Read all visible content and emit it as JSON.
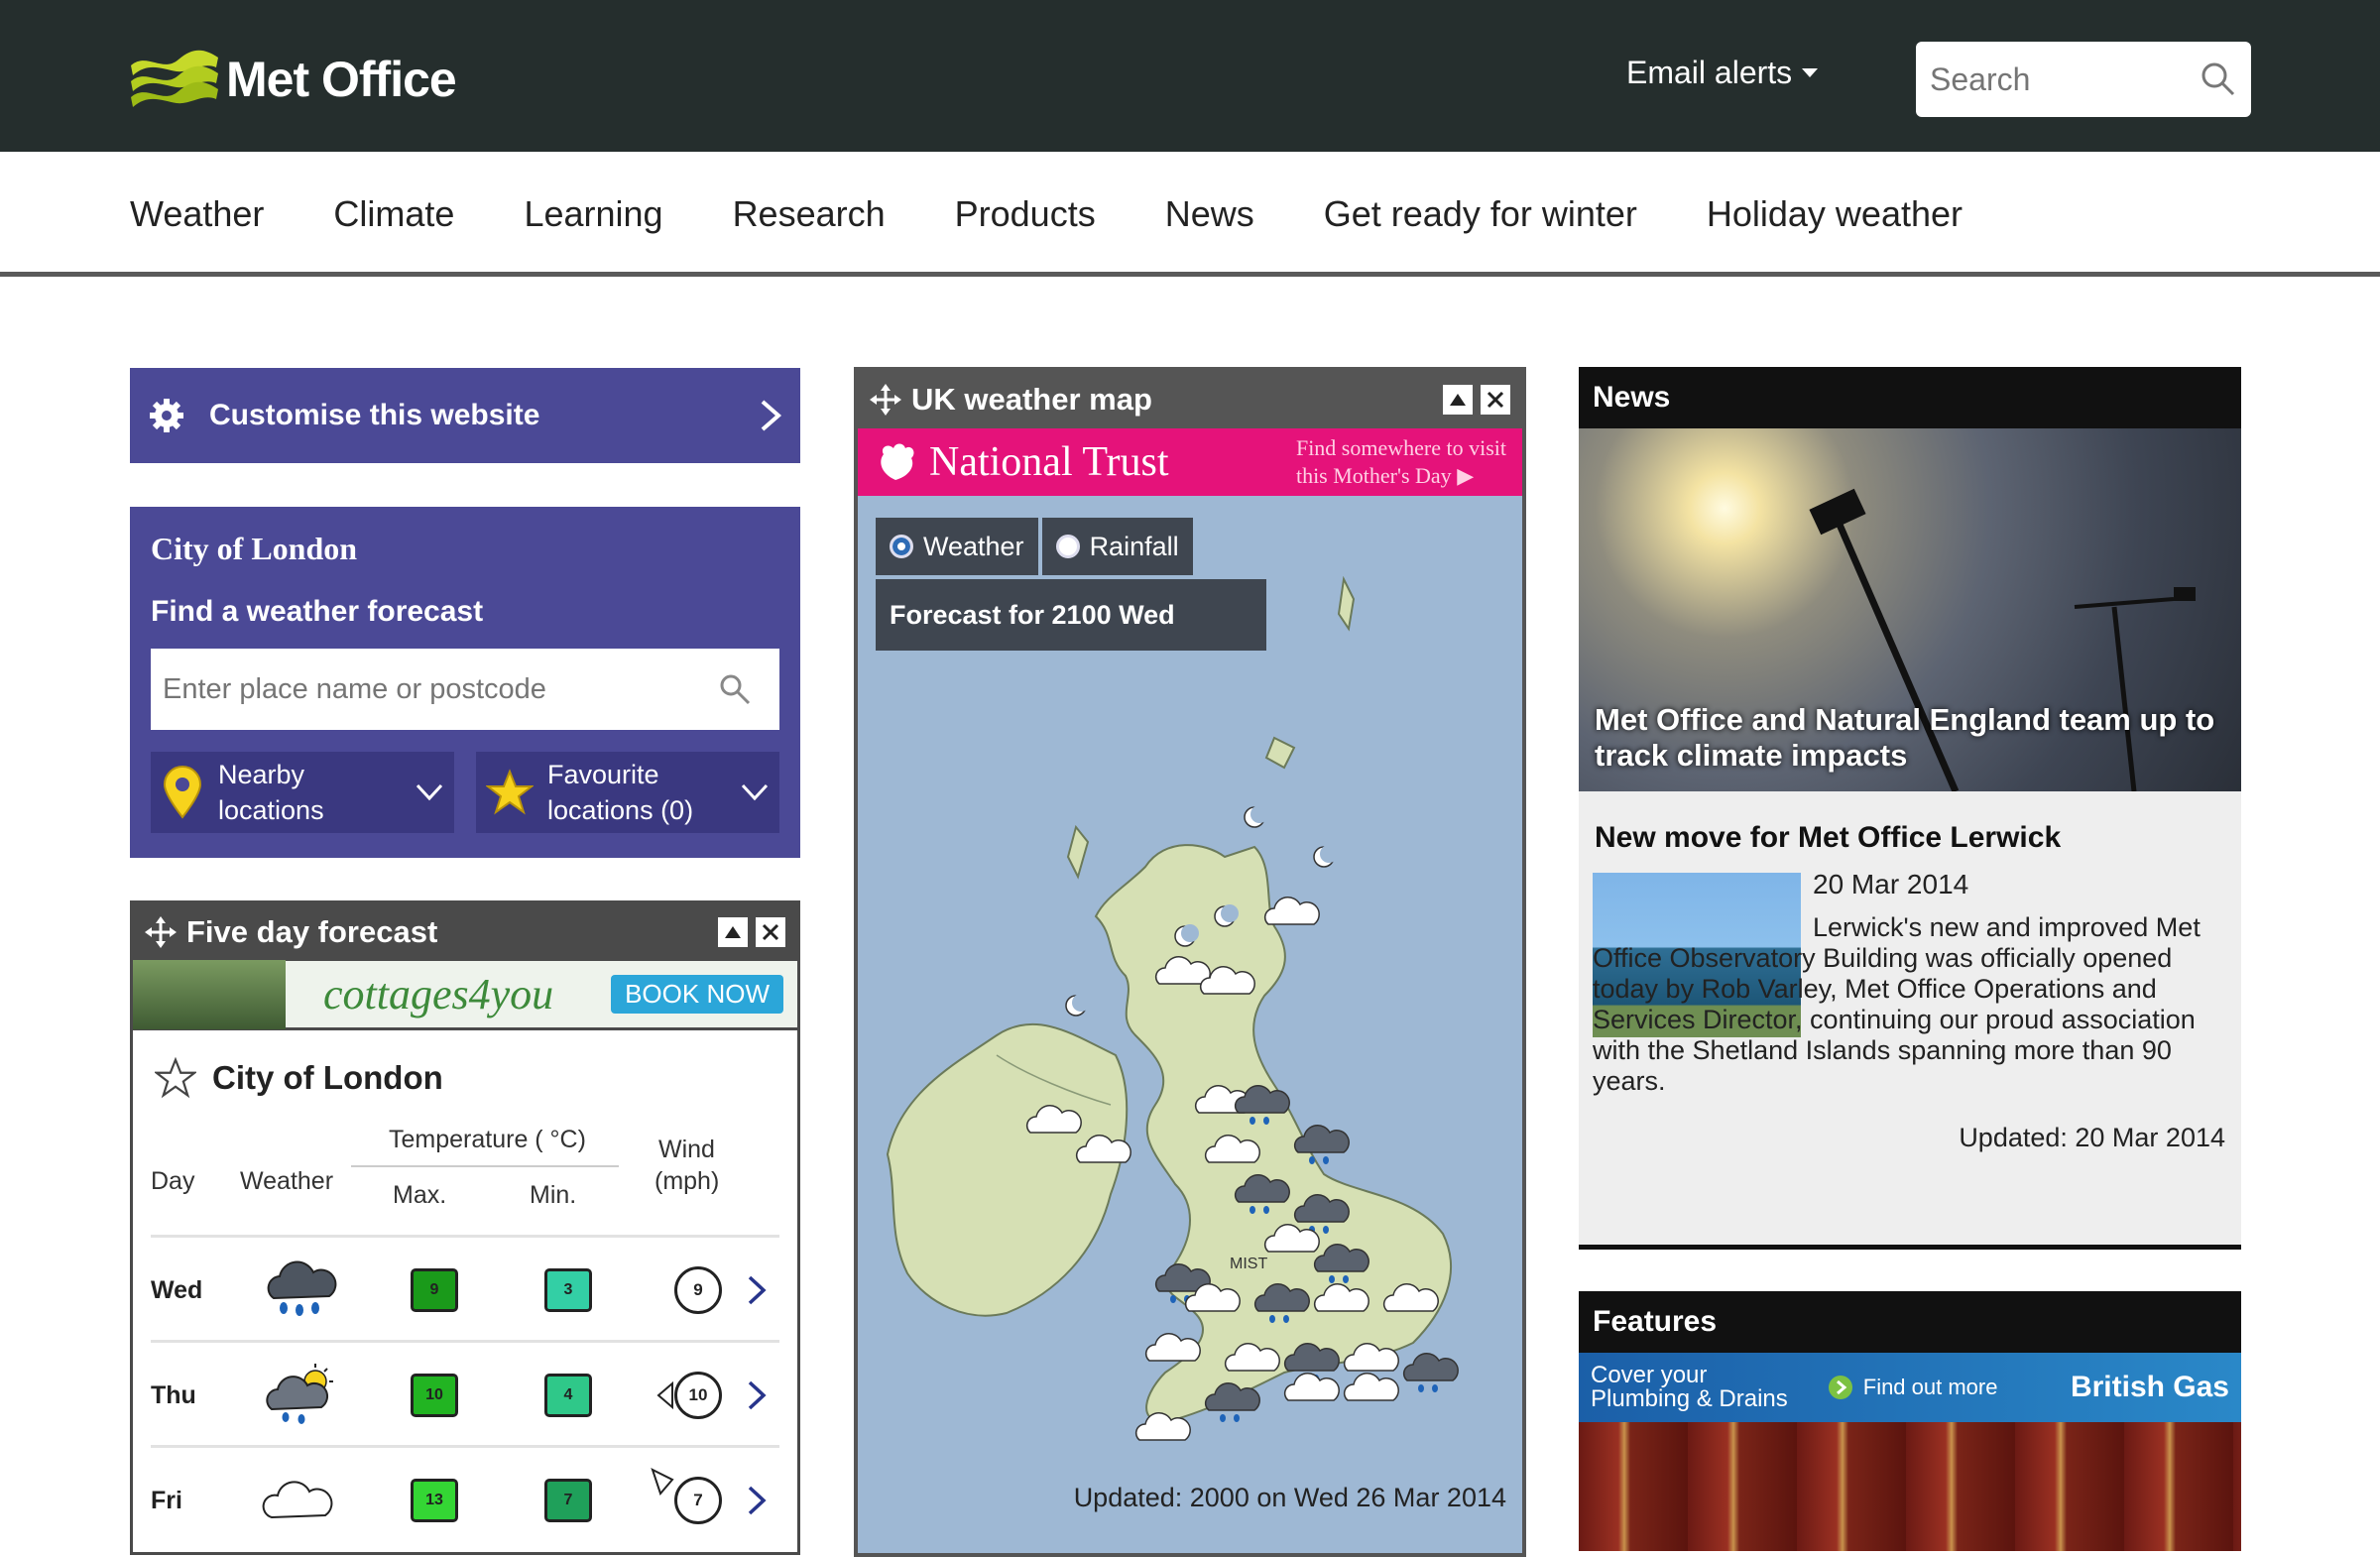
{
  "header": {
    "logo_text": "Met Office",
    "email_alerts": "Email alerts",
    "search_placeholder": "Search"
  },
  "nav": {
    "items": [
      "Weather",
      "Climate",
      "Learning",
      "Research",
      "Products",
      "News",
      "Get ready for winter",
      "Holiday weather"
    ]
  },
  "customise": {
    "label": "Customise this website"
  },
  "city_panel": {
    "title": "City of London",
    "find_label": "Find a weather forecast",
    "input_placeholder": "Enter place name or postcode",
    "nearby": [
      "Nearby",
      "locations"
    ],
    "favourite": [
      "Favourite",
      "locations (0)"
    ]
  },
  "five_day": {
    "title": "Five day forecast",
    "ad_brand": "cottages4you",
    "ad_button": "BOOK NOW",
    "location": "City of London",
    "headers": {
      "day": "Day",
      "weather": "Weather",
      "temperature": "Temperature ( °C)",
      "max": "Max.",
      "min": "Min.",
      "wind": "Wind",
      "wind_unit": "(mph)"
    },
    "rows": [
      {
        "day": "Wed",
        "weather_icon": "heavy-rain-cloud-icon",
        "max": "9",
        "min": "3",
        "wind": "9",
        "max_color": "#1a9a1a",
        "min_color": "#33cfa5"
      },
      {
        "day": "Thu",
        "weather_icon": "sun-cloud-rain-icon",
        "max": "10",
        "min": "4",
        "wind": "10",
        "max_color": "#22b422",
        "min_color": "#2fc889"
      },
      {
        "day": "Fri",
        "weather_icon": "cloud-icon",
        "max": "13",
        "min": "7",
        "wind": "7",
        "max_color": "#34d634",
        "min_color": "#1fa05a"
      }
    ]
  },
  "map_widget": {
    "title": "UK weather map",
    "ad_brand": "National Trust",
    "ad_tagline": [
      "Find somewhere to visit",
      "this Mother's Day"
    ],
    "tabs": [
      "Weather",
      "Rainfall"
    ],
    "forecast_label": "Forecast for 2100 Wed",
    "mist_label": "MIST",
    "updated": "Updated: 2000 on Wed 26 Mar 2014"
  },
  "news": {
    "title": "News",
    "hero_caption": "Met Office and Natural England team up to track climate impacts",
    "headline": "New move for Met Office Lerwick",
    "date": "20 Mar 2014",
    "body": "Lerwick's new and improved Met Office Observatory Building was officially opened today by Rob Varley, Met Office Operations and Services Director, continuing our proud association with the Shetland Islands spanning more than 90 years.",
    "updated": "Updated: 20 Mar 2014"
  },
  "features": {
    "title": "Features",
    "ad_line1": "Cover your",
    "ad_line2": "Plumbing & Drains",
    "ad_find": "Find out more",
    "ad_brand": "British Gas"
  },
  "colors": {
    "header_bg": "#252e2d",
    "panel_purple": "#4b4996",
    "nt_pink": "#e5127a",
    "map_sea": "#9eb8d4",
    "land": "#d6e0b4"
  }
}
